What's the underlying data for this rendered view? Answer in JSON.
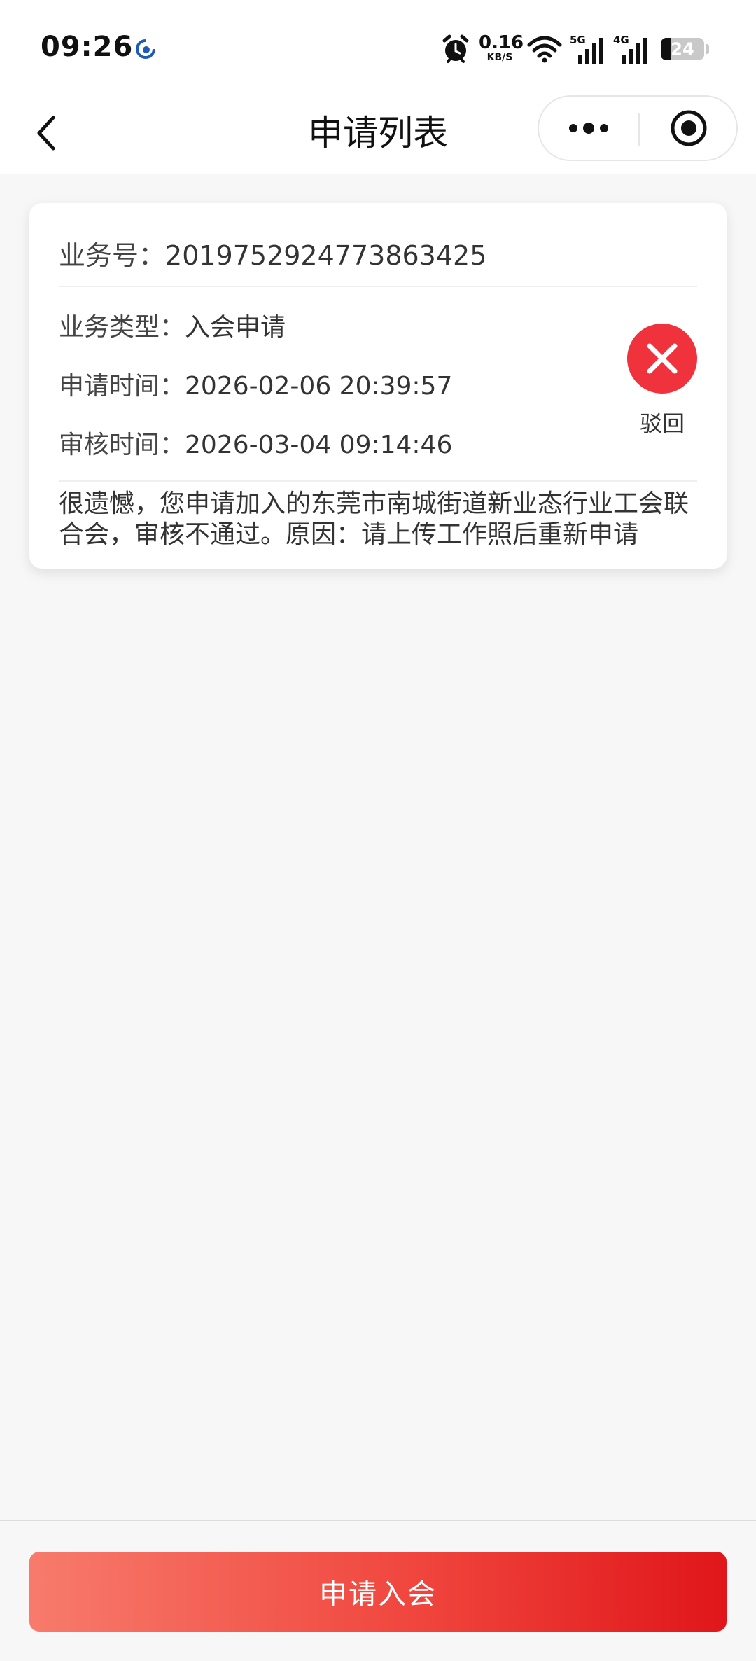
{
  "status_bar": {
    "time": "09:26",
    "net_speed_value": "0.16",
    "net_speed_unit": "KB/S",
    "sig1_label": "5G",
    "sig2_label": "4G",
    "battery_level": "24"
  },
  "nav": {
    "title": "申请列表"
  },
  "application": {
    "business_no_label": "业务号：",
    "business_no": "2019752924773863425",
    "type_label": "业务类型：",
    "type": "入会申请",
    "apply_time_label": "申请时间：",
    "apply_time": "2026-02-06 20:39:57",
    "review_time_label": "审核时间：",
    "review_time": "2026-03-04 09:14:46",
    "status": "驳回",
    "reason": "很遗憾，您申请加入的东莞市南城街道新业态行业工会联合会，审核不通过。原因：请上传工作照后重新申请"
  },
  "bottom": {
    "apply_button": "申请入会"
  },
  "colors": {
    "accent_red": "#f0323c",
    "button_gradient_start": "#f77b6c",
    "button_gradient_end": "#e0161a"
  },
  "icons": {
    "back": "chevron-left-icon",
    "more": "more-dots-icon",
    "close": "target-circle-icon",
    "status": "x-circle-icon"
  }
}
